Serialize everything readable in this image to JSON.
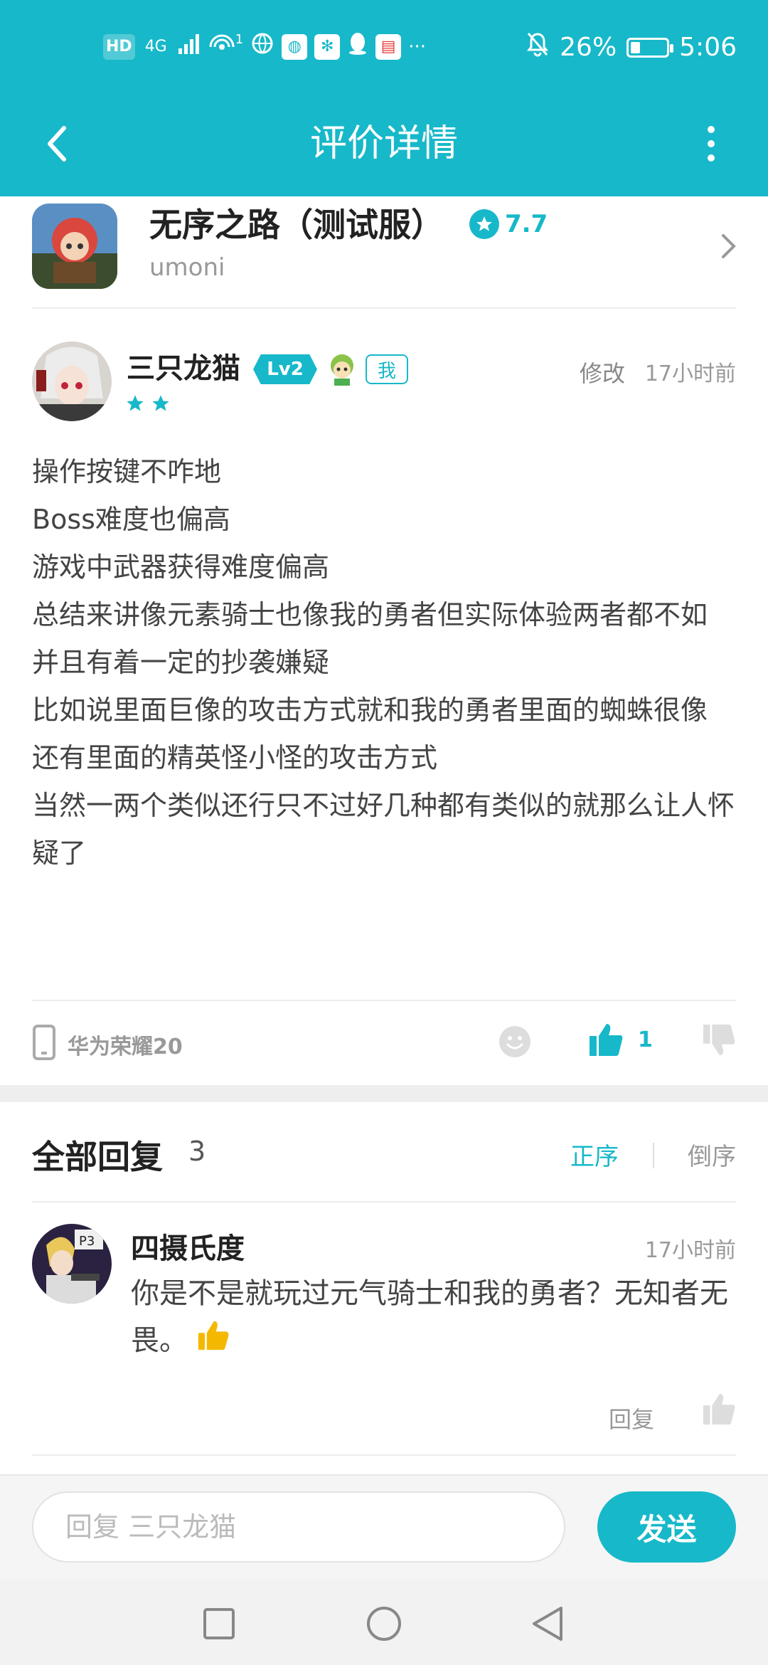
{
  "status_bar": {
    "left_icons": [
      "HD",
      "4G",
      "signal-icon",
      "hotspot-icon",
      "globe-icon",
      "browser-icon",
      "baidu-icon",
      "qq-icon",
      "reader-icon",
      "more-dots"
    ],
    "hd_label": "HD",
    "net_label": "4G",
    "hotspot_count": "1",
    "battery": "26%",
    "battery_level": 0.26,
    "time": "5:06"
  },
  "header": {
    "title": "评价详情"
  },
  "game": {
    "title": "无序之路（测试服）",
    "rating": "7.7",
    "developer": "umoni"
  },
  "review": {
    "author": "三只龙猫",
    "level": "Lv2",
    "me_tag": "我",
    "stars": 2,
    "edit_label": "修改",
    "time": "17小时前",
    "lines": [
      "操作按键不咋地",
      "Boss难度也偏高",
      "游戏中武器获得难度偏高",
      "总结来讲像元素骑士也像我的勇者但实际体验两者都不如",
      "并且有着一定的抄袭嫌疑",
      "比如说里面巨像的攻击方式就和我的勇者里面的蜘蛛很像",
      "还有里面的精英怪小怪的攻击方式",
      "当然一两个类似还行只不过好几种都有类似的就那么让人怀疑了"
    ],
    "device": "华为荣耀20",
    "likes": "1"
  },
  "replies": {
    "title": "全部回复",
    "count": "3",
    "sort_asc": "正序",
    "sort_desc": "倒序",
    "items": [
      {
        "author": "四摄氏度",
        "time": "17小时前",
        "text": "你是不是就玩过元气骑士和我的勇者？无知者无畏。",
        "action": "回复"
      }
    ]
  },
  "composer": {
    "placeholder": "回复 三只龙猫",
    "send_label": "发送"
  },
  "colors": {
    "accent": "#17b8c9",
    "like_active": "#17b8c9",
    "star": "#17b8c9"
  }
}
